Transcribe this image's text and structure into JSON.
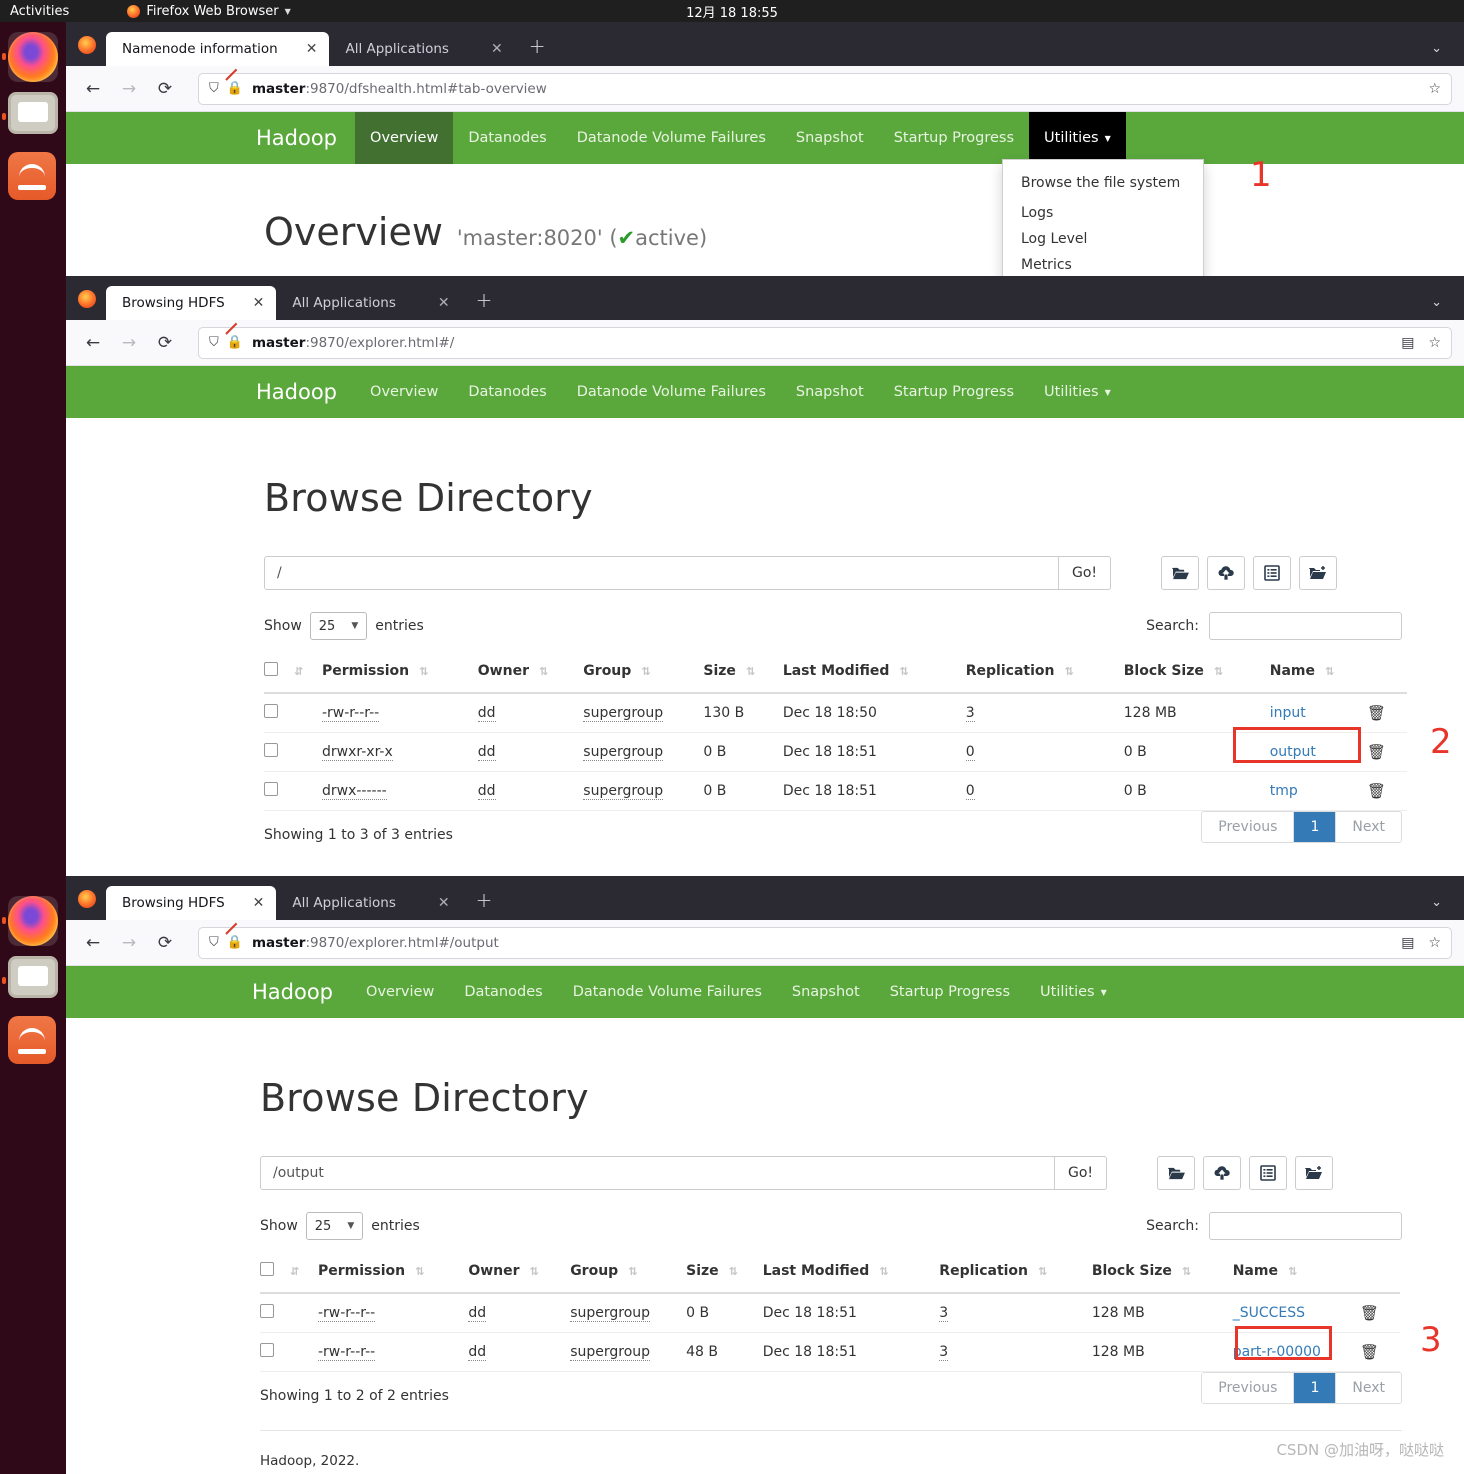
{
  "desktop": {
    "activities": "Activities",
    "app_menu": "Firefox Web Browser",
    "clock": "12月 18 18:55",
    "dock_items": [
      {
        "name": "Firefox Web Browser"
      },
      {
        "name": "Files"
      },
      {
        "name": "Ubuntu Software"
      }
    ]
  },
  "colors": {
    "hadoop_green": "#5aa83c",
    "hadoop_green_active": "#417030",
    "link_blue": "#337ab7",
    "annotation_red": "#e8352a",
    "ubuntu_orange": "#e95420"
  },
  "windows": [
    {
      "id": "window-namenode",
      "tabs": [
        {
          "label": "Namenode information",
          "active": true
        },
        {
          "label": "All Applications",
          "active": false
        }
      ],
      "new_tab_label": "+",
      "url": {
        "host": "master",
        "rest": ":9870/dfshealth.html#tab-overview",
        "full": "master:9870/dfshealth.html#tab-overview"
      },
      "nav": {
        "brand": "Hadoop",
        "items": [
          {
            "label": "Overview",
            "state": "active"
          },
          {
            "label": "Datanodes",
            "state": "normal"
          },
          {
            "label": "Datanode Volume Failures",
            "state": "normal"
          },
          {
            "label": "Snapshot",
            "state": "normal"
          },
          {
            "label": "Startup Progress",
            "state": "normal"
          },
          {
            "label": "Utilities",
            "state": "open",
            "caret": "▾"
          }
        ]
      },
      "dropdown": {
        "items": [
          "Browse the file system",
          "Logs",
          "Log Level",
          "Metrics"
        ],
        "highlighted": "Browse the file system"
      },
      "heading": {
        "title": "Overview",
        "subtitle": "'master:8020' (",
        "status": "active",
        "check": "✔",
        "suffix": ")"
      },
      "annotation": "1"
    },
    {
      "id": "window-browse-root",
      "tabs": [
        {
          "label": "Browsing HDFS",
          "active": true
        },
        {
          "label": "All Applications",
          "active": false
        }
      ],
      "new_tab_label": "+",
      "url": {
        "host": "master",
        "rest": ":9870/explorer.html#/",
        "full": "master:9870/explorer.html#/"
      },
      "nav": {
        "brand": "Hadoop",
        "items": [
          {
            "label": "Overview",
            "state": "normal"
          },
          {
            "label": "Datanodes",
            "state": "normal"
          },
          {
            "label": "Datanode Volume Failures",
            "state": "normal"
          },
          {
            "label": "Snapshot",
            "state": "normal"
          },
          {
            "label": "Startup Progress",
            "state": "normal"
          },
          {
            "label": "Utilities",
            "state": "normal",
            "caret": "▾"
          }
        ]
      },
      "heading": "Browse Directory",
      "path_value": "/",
      "go_label": "Go!",
      "toolbar_icons": [
        "folder-open-icon",
        "cloud-upload-icon",
        "permissions-list-icon",
        "new-folder-icon"
      ],
      "show_label": "Show",
      "entries_label": "entries",
      "page_size": "25",
      "search_label": "Search:",
      "search_value": "",
      "columns": [
        "Permission",
        "Owner",
        "Group",
        "Size",
        "Last Modified",
        "Replication",
        "Block Size",
        "Name"
      ],
      "rows": [
        {
          "permission": "-rw-r--r--",
          "owner": "dd",
          "group": "supergroup",
          "size": "130 B",
          "modified": "Dec 18 18:50",
          "replication": "3",
          "block_size": "128 MB",
          "name": "input",
          "highlight": false
        },
        {
          "permission": "drwxr-xr-x",
          "owner": "dd",
          "group": "supergroup",
          "size": "0 B",
          "modified": "Dec 18 18:51",
          "replication": "0",
          "block_size": "0 B",
          "name": "output",
          "highlight": true
        },
        {
          "permission": "drwx------",
          "owner": "dd",
          "group": "supergroup",
          "size": "0 B",
          "modified": "Dec 18 18:51",
          "replication": "0",
          "block_size": "0 B",
          "name": "tmp",
          "highlight": false
        }
      ],
      "showing": "Showing 1 to 3 of 3 entries",
      "pager": {
        "previous": "Previous",
        "current": "1",
        "next": "Next"
      },
      "annotation": "2"
    },
    {
      "id": "window-browse-output",
      "tabs": [
        {
          "label": "Browsing HDFS",
          "active": true
        },
        {
          "label": "All Applications",
          "active": false
        }
      ],
      "new_tab_label": "+",
      "url": {
        "host": "master",
        "rest": ":9870/explorer.html#/output",
        "full": "master:9870/explorer.html#/output"
      },
      "nav": {
        "brand": "Hadoop",
        "items": [
          {
            "label": "Overview",
            "state": "normal"
          },
          {
            "label": "Datanodes",
            "state": "normal"
          },
          {
            "label": "Datanode Volume Failures",
            "state": "normal"
          },
          {
            "label": "Snapshot",
            "state": "normal"
          },
          {
            "label": "Startup Progress",
            "state": "normal"
          },
          {
            "label": "Utilities",
            "state": "normal",
            "caret": "▾"
          }
        ]
      },
      "heading": "Browse Directory",
      "path_value": "/output",
      "go_label": "Go!",
      "toolbar_icons": [
        "folder-open-icon",
        "cloud-upload-icon",
        "permissions-list-icon",
        "new-folder-icon"
      ],
      "show_label": "Show",
      "entries_label": "entries",
      "page_size": "25",
      "search_label": "Search:",
      "search_value": "",
      "columns": [
        "Permission",
        "Owner",
        "Group",
        "Size",
        "Last Modified",
        "Replication",
        "Block Size",
        "Name"
      ],
      "rows": [
        {
          "permission": "-rw-r--r--",
          "owner": "dd",
          "group": "supergroup",
          "size": "0 B",
          "modified": "Dec 18 18:51",
          "replication": "3",
          "block_size": "128 MB",
          "name": "_SUCCESS",
          "highlight": false
        },
        {
          "permission": "-rw-r--r--",
          "owner": "dd",
          "group": "supergroup",
          "size": "48 B",
          "modified": "Dec 18 18:51",
          "replication": "3",
          "block_size": "128 MB",
          "name": "part-r-00000",
          "highlight": true
        }
      ],
      "showing": "Showing 1 to 2 of 2 entries",
      "pager": {
        "previous": "Previous",
        "current": "1",
        "next": "Next"
      },
      "footer": "Hadoop, 2022.",
      "annotation": "3"
    }
  ],
  "watermark": "CSDN @加油呀，哒哒哒"
}
